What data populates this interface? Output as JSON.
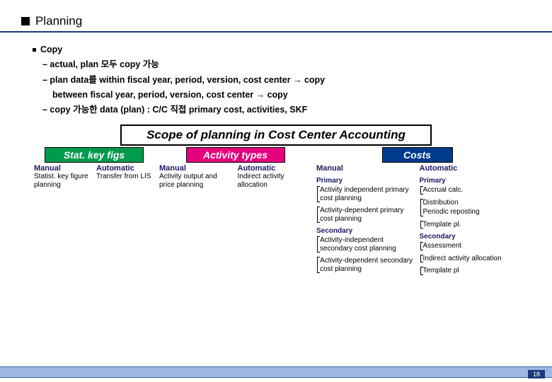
{
  "header": {
    "title": "Planning"
  },
  "copy_section": {
    "heading": "Copy",
    "sub1": "– actual, plan 모두 copy 가능",
    "sub2": "– plan data를 within fiscal year, period, version, cost center → copy",
    "sub2b": "between fiscal year, period, version, cost center → copy",
    "sub3": "– copy 가능한 data (plan) : C/C 직접 primary cost, activities, SKF"
  },
  "diagram": {
    "title": "Scope of planning in Cost Center Accounting",
    "cat1": {
      "label": "Stat. key figs",
      "manual": {
        "heading": "Manual",
        "text": "Statist. key figure planning"
      },
      "auto": {
        "heading": "Automatic",
        "text": "Transfer from LIS"
      }
    },
    "cat2": {
      "label": "Activity types",
      "manual": {
        "heading": "Manual",
        "text": "Activity output and price planning"
      },
      "auto": {
        "heading": "Automatic",
        "text": "Indirect activity allocation"
      }
    },
    "cat3": {
      "label": "Costs",
      "manual": {
        "heading": "Manual",
        "primary_label": "Primary",
        "p1": "Activity independent primary cost planning",
        "p2": "Activity-dependent primary cost planning",
        "secondary_label": "Secondary",
        "s1": "Activity-independent secondary cost planning",
        "s2": "Activity-dependent secondary cost planning"
      },
      "auto": {
        "heading": "Automatic",
        "primary_label": "Primary",
        "p1": "Accrual calc.",
        "p2": "Distribution",
        "p3": "Periodic reposting",
        "p4": "Template pl.",
        "secondary_label": "Secondary",
        "s1": "Assessment",
        "s2": "Indirect activity allocation",
        "s3": "Template pl"
      }
    }
  },
  "footer": {
    "page": "18"
  }
}
